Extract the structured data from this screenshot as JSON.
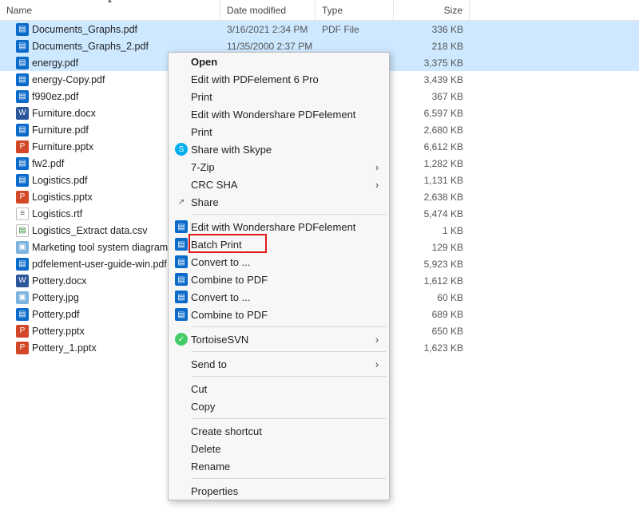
{
  "columns": {
    "name": "Name",
    "date": "Date modified",
    "type": "Type",
    "size": "Size"
  },
  "sort_column": "name",
  "files": [
    {
      "name": "Documents_Graphs.pdf",
      "icon": "pdf",
      "date": "3/16/2021 2:34 PM",
      "type": "PDF File",
      "size": "336 KB",
      "selected": true
    },
    {
      "name": "Documents_Graphs_2.pdf",
      "icon": "pdf",
      "date": "11/35/2000 2:37 PM",
      "type": "",
      "size": "218 KB",
      "selected": true
    },
    {
      "name": "energy.pdf",
      "icon": "pdf",
      "date": "",
      "type": "",
      "size": "3,375 KB",
      "selected": true
    },
    {
      "name": "energy-Copy.pdf",
      "icon": "pdf",
      "date": "",
      "type": "",
      "size": "3,439 KB"
    },
    {
      "name": "f990ez.pdf",
      "icon": "pdf",
      "date": "",
      "type": "",
      "size": "367 KB"
    },
    {
      "name": "Furniture.docx",
      "icon": "docx",
      "date": "",
      "type": "",
      "size": "6,597 KB"
    },
    {
      "name": "Furniture.pdf",
      "icon": "pdf",
      "date": "",
      "type": "",
      "size": "2,680 KB"
    },
    {
      "name": "Furniture.pptx",
      "icon": "pptx",
      "date": "",
      "type": "",
      "size": "6,612 KB"
    },
    {
      "name": "fw2.pdf",
      "icon": "pdf",
      "date": "",
      "type": "",
      "size": "1,282 KB"
    },
    {
      "name": "Logistics.pdf",
      "icon": "pdf",
      "date": "",
      "type": "",
      "size": "1,131 KB"
    },
    {
      "name": "Logistics.pptx",
      "icon": "pptx",
      "date": "",
      "type": "",
      "size": "2,638 KB"
    },
    {
      "name": "Logistics.rtf",
      "icon": "rtf",
      "date": "",
      "type": "",
      "size": "5,474 KB"
    },
    {
      "name": "Logistics_Extract data.csv",
      "icon": "csv",
      "date": "",
      "type": "",
      "size": "1 KB"
    },
    {
      "name": "Marketing tool system diagram",
      "icon": "jpg",
      "date": "",
      "type": "",
      "size": "129 KB"
    },
    {
      "name": "pdfelement-user-guide-win.pdf",
      "icon": "pdf",
      "date": "",
      "type": "",
      "size": "5,923 KB"
    },
    {
      "name": "Pottery.docx",
      "icon": "docx",
      "date": "",
      "type": "",
      "size": "1,612 KB"
    },
    {
      "name": "Pottery.jpg",
      "icon": "jpg",
      "date": "",
      "type": "",
      "size": "60 KB"
    },
    {
      "name": "Pottery.pdf",
      "icon": "pdf",
      "date": "",
      "type": "",
      "size": "689 KB"
    },
    {
      "name": "Pottery.pptx",
      "icon": "pptx",
      "date": "",
      "type": "",
      "size": "650 KB"
    },
    {
      "name": "Pottery_1.pptx",
      "icon": "pptx",
      "date": "",
      "type": "",
      "size": "1,623 KB"
    }
  ],
  "context_menu": [
    {
      "label": "Open",
      "bold": true
    },
    {
      "label": "Edit with PDFelement 6 Pro"
    },
    {
      "label": "Print"
    },
    {
      "label": "Edit with Wondershare PDFelement"
    },
    {
      "label": "Print"
    },
    {
      "label": "Share with Skype",
      "icon": "skype"
    },
    {
      "label": "7-Zip",
      "submenu": true
    },
    {
      "label": "CRC SHA",
      "submenu": true
    },
    {
      "label": "Share",
      "icon": "share"
    },
    {
      "sep": true
    },
    {
      "label": "Edit with Wondershare PDFelement",
      "icon": "pdfel"
    },
    {
      "label": "Batch Print",
      "icon": "pdfel",
      "highlight": true
    },
    {
      "label": "Convert to ...",
      "icon": "pdfel"
    },
    {
      "label": "Combine to PDF",
      "icon": "pdfel"
    },
    {
      "label": "Convert to ...",
      "icon": "pdfel"
    },
    {
      "label": "Combine to PDF",
      "icon": "pdfel"
    },
    {
      "sep": true
    },
    {
      "label": "TortoiseSVN",
      "icon": "tsvn",
      "submenu": true
    },
    {
      "sep": true
    },
    {
      "label": "Send to",
      "submenu": true
    },
    {
      "sep": true
    },
    {
      "label": "Cut"
    },
    {
      "label": "Copy"
    },
    {
      "sep": true
    },
    {
      "label": "Create shortcut"
    },
    {
      "label": "Delete"
    },
    {
      "label": "Rename"
    },
    {
      "sep": true
    },
    {
      "label": "Properties"
    }
  ]
}
